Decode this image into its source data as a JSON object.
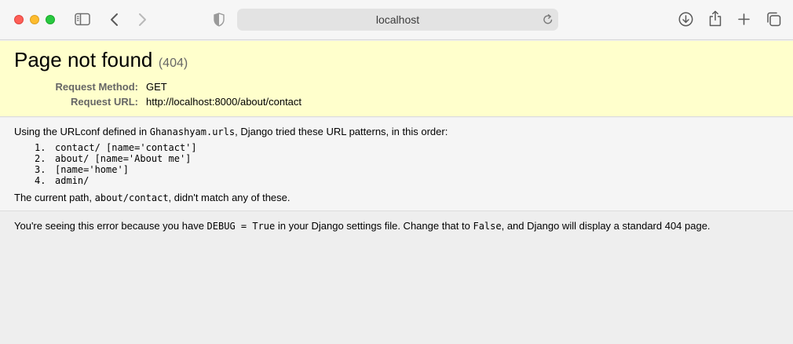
{
  "browser": {
    "address": "localhost",
    "icons": [
      "sidebar-icon",
      "back-icon",
      "forward-icon",
      "shield-icon",
      "reload-icon",
      "download-icon",
      "share-icon",
      "new-tab-icon",
      "tabs-overview-icon"
    ]
  },
  "summary": {
    "title": "Page not found",
    "code": "(404)",
    "method_label": "Request Method:",
    "method_value": "GET",
    "url_label": "Request URL:",
    "url_value": "http://localhost:8000/about/contact"
  },
  "info": {
    "intro_before": "Using the URLconf defined in ",
    "urlconf": "Ghanashyam.urls",
    "intro_after": ", Django tried these URL patterns, in this order:",
    "patterns": [
      {
        "num": "1.",
        "text": "contact/ [name='contact']"
      },
      {
        "num": "2.",
        "text": "about/ [name='About me']"
      },
      {
        "num": "3.",
        "text": "[name='home']"
      },
      {
        "num": "4.",
        "text": "admin/"
      }
    ],
    "current_before": "The current path, ",
    "current_path": "about/contact",
    "current_after": ", didn't match any of these."
  },
  "explanation": {
    "before": "You're seeing this error because you have ",
    "debug_code": "DEBUG = True",
    "middle": " in your Django settings file. Change that to ",
    "false_code": "False",
    "after": ", and Django will display a standard 404 page."
  },
  "colors": {
    "summary_bg": "#ffffcc",
    "info_bg": "#f5f5f5",
    "page_bg": "#eeeeee"
  }
}
